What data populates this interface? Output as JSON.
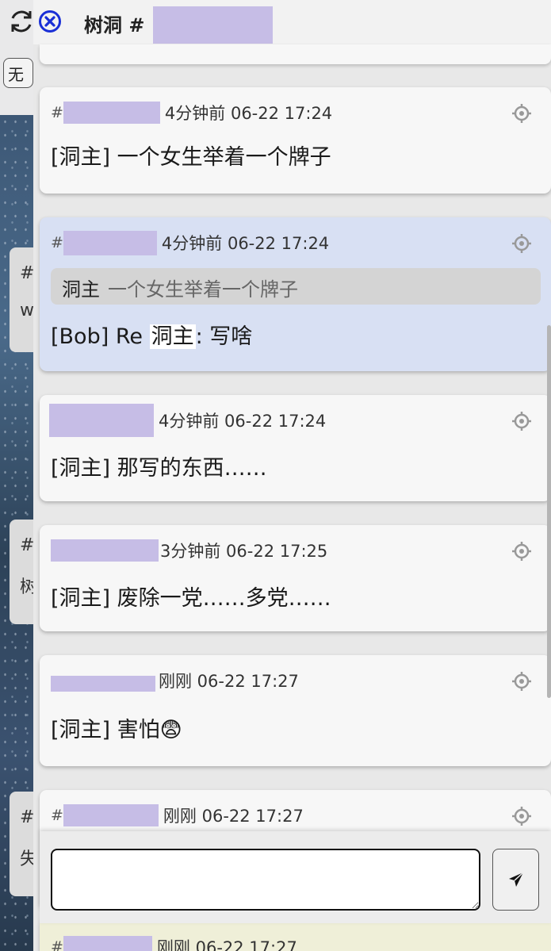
{
  "background": {
    "chip_label": "无",
    "side_cards": [
      {
        "hash": "#",
        "text": "w"
      },
      {
        "hash": "#",
        "text": "树"
      },
      {
        "hash": "#",
        "text": "失"
      }
    ]
  },
  "dialog": {
    "title": "树洞 #",
    "colors": {
      "redaction": "#c6bde6",
      "highlight": "#d8e0f3",
      "close": "#1a2fd6"
    }
  },
  "replies": [
    {
      "hash": "#",
      "time": "4分钟前 06-22 17:24",
      "text": "[洞主] 一个女生举着一个牌子"
    },
    {
      "hash": "#",
      "time": "4分钟前 06-22 17:24",
      "quote_name": "洞主",
      "quote_text": "一个女生举着一个牌子",
      "text_prefix": "[Bob] Re ",
      "text_mark": "洞主",
      "text_suffix": ": 写啥"
    },
    {
      "hash": "",
      "time": "4分钟前 06-22 17:24",
      "text": "[洞主] 那写的东西……"
    },
    {
      "hash": "",
      "time": "3分钟前 06-22 17:25",
      "text": "[洞主] 废除一党……多党……"
    },
    {
      "hash": "",
      "time": "刚刚 06-22 17:27",
      "text": "[洞主] 害怕😨"
    },
    {
      "hash": "#",
      "time": "刚刚 06-22 17:27",
      "text": ""
    },
    {
      "hash": "#",
      "time": "刚刚 06-22 17:27",
      "text": ""
    }
  ],
  "composer": {
    "placeholder": ""
  }
}
